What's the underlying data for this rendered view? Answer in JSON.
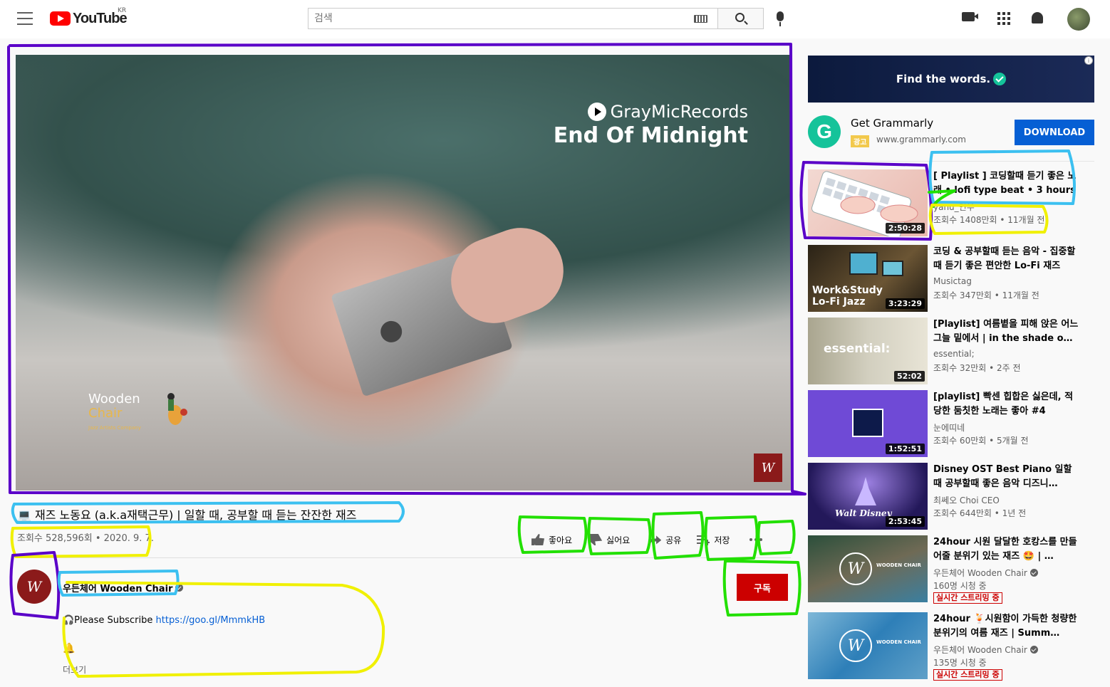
{
  "header": {
    "logo_text": "YouTube",
    "country_code": "KR",
    "search_placeholder": "검색"
  },
  "player": {
    "watermark_brand": "GrayMicRecords",
    "watermark_title": "End Of Midnight",
    "channel_watermark_line1": "Wooden",
    "channel_watermark_line2": "Chair",
    "channel_watermark_line3": "Jazz Artists Company",
    "corner_logo": "W"
  },
  "video": {
    "title": "💻 재즈 노동요 (a.k.a재택근무) | 일할 때, 공부할 때 듣는 잔잔한 재즈",
    "meta": "조회수 528,596회 • 2020. 9. 7.",
    "actions": {
      "like": "좋아요",
      "dislike": "싫어요",
      "share": "공유",
      "save": "저장"
    }
  },
  "channel": {
    "avatar": "W",
    "name": "우든체어 Wooden Chair",
    "subscribe": "구독",
    "desc_prefix": "🎧Please Subscribe ",
    "desc_link": "https://goo.gl/MmmkHB",
    "desc_bell": "🔔",
    "more": "더보기"
  },
  "ad": {
    "banner_text": "Find the words.",
    "info": "i",
    "logo_letter": "G",
    "title": "Get Grammarly",
    "badge": "광고",
    "url": "www.grammarly.com",
    "button": "DOWNLOAD"
  },
  "recommendations": [
    {
      "title": "[ Playlist ] 코딩할때 듣기 좋은 노래 • lofi type beat • 3 hours",
      "channel": "yanu_연우",
      "stats": "조회수 1408만회 • 11개월 전",
      "duration": "2:50:28"
    },
    {
      "title": "코딩 & 공부할때 듣는 음악 - 집중할때 듣기 좋은 편안한 Lo-Fi 재즈",
      "channel": "Musictag",
      "stats": "조회수 347만회 • 11개월 전",
      "duration": "3:23:29",
      "thumb_line1": "Work&Study",
      "thumb_line2": "Lo-Fi Jazz"
    },
    {
      "title": "[Playlist] 여름볕을 피해 앉은 어느 그늘 밑에서 | in the shade o…",
      "channel": "essential;",
      "stats": "조회수 32만회 • 2주 전",
      "duration": "52:02",
      "thumb_text": "essential:"
    },
    {
      "title": "[playlist] 빡센 힙합은 싫은데, 적당한 둠칫한 노래는 좋아 #4",
      "channel": "눈에띠네",
      "stats": "조회수 60만회 • 5개월 전",
      "duration": "1:52:51"
    },
    {
      "title": "Disney OST Best Piano 일할때 공부할때 좋은 음악 디즈니…",
      "channel": "최쎄오 Choi CEO",
      "stats": "조회수 644만회 • 1년 전",
      "duration": "2:53:45",
      "thumb_text": "Walt Disney"
    },
    {
      "title": "24hour 시원 달달한 호캉스를 만들어줄 분위기 있는 재즈 🤩 | …",
      "channel": "우든체어 Wooden Chair",
      "stats": "160명 시청 중",
      "live": "실시간 스트리밍 중",
      "thumb_logo": "W",
      "thumb_caption": "WOODEN CHAIR"
    },
    {
      "title": "24hour 🍹시원함이 가득한 청량한 분위기의 여름 재즈 | Summ…",
      "channel": "우든체어 Wooden Chair",
      "stats": "135명 시청 중",
      "live": "실시간 스트리밍 중",
      "thumb_logo": "W",
      "thumb_caption": "WOODEN CHAIR"
    }
  ],
  "colors": {
    "brand_red": "#ff0000",
    "subscribe_red": "#cc0000",
    "link_blue": "#065fd4",
    "annotation_purple": "#5a00c8",
    "annotation_blue": "#3cc0f0",
    "annotation_yellow": "#f0f000",
    "annotation_green": "#22e000"
  }
}
